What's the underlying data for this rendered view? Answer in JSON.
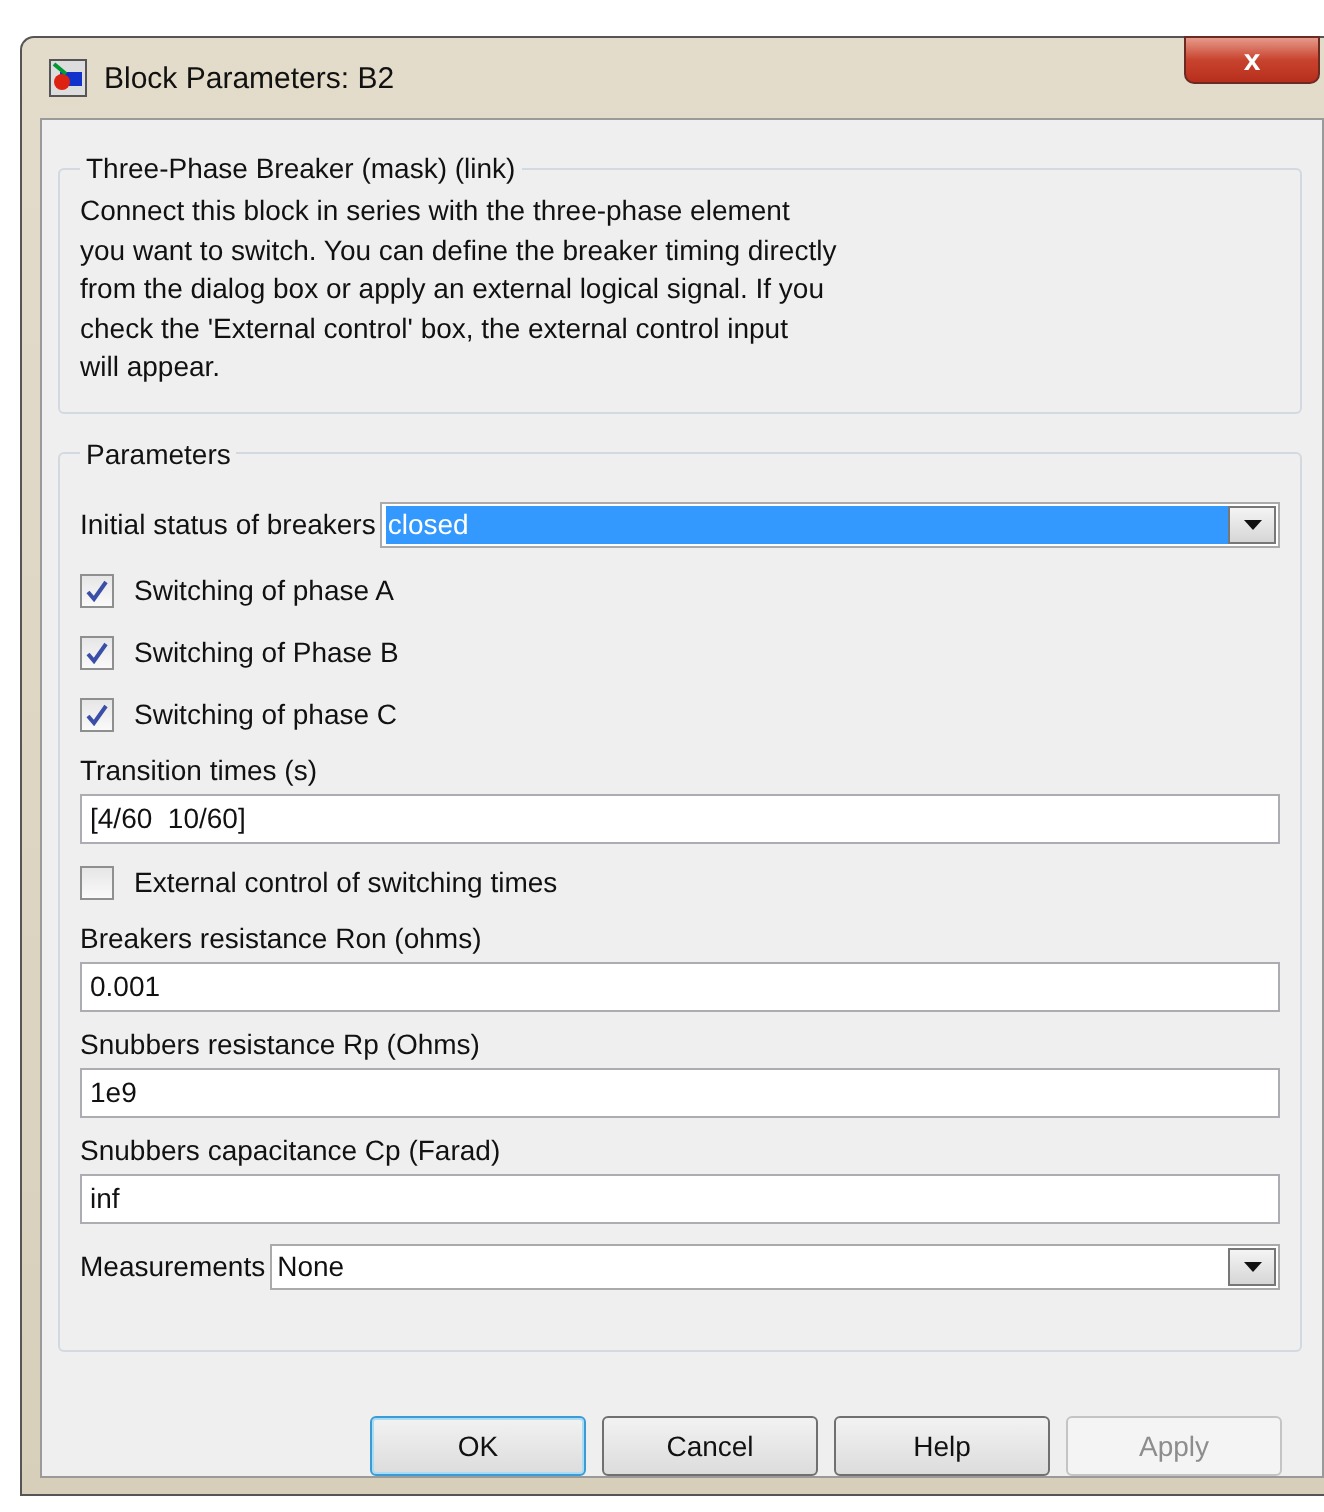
{
  "window": {
    "title": "Block Parameters: B2",
    "close": "x"
  },
  "description": {
    "heading": "Three-Phase Breaker (mask) (link)",
    "text": "Connect this block in series with the three-phase element\nyou want to switch. You can define the breaker timing directly\nfrom the dialog box or apply an external logical signal. If you\ncheck  the 'External control' box, the external control input\nwill appear."
  },
  "parameters": {
    "heading": "Parameters",
    "items": [
      {
        "kind": "dropdown",
        "label": "Initial status of breakers",
        "value": "closed",
        "focused": true
      },
      {
        "kind": "checkbox",
        "label": "Switching of phase A",
        "checked": true
      },
      {
        "kind": "checkbox",
        "label": "Switching of Phase B",
        "checked": true
      },
      {
        "kind": "checkbox",
        "label": "Switching of phase C",
        "checked": true
      },
      {
        "kind": "field",
        "label": "Transition times (s)",
        "value": "[4/60  10/60]"
      },
      {
        "kind": "checkbox",
        "label": "External control of switching times",
        "checked": false
      },
      {
        "kind": "field",
        "label": "Breakers resistance Ron (ohms)",
        "value": "0.001"
      },
      {
        "kind": "field",
        "label": "Snubbers resistance Rp (Ohms)",
        "value": "1e9"
      },
      {
        "kind": "field",
        "label": "Snubbers capacitance Cp (Farad)",
        "value": "inf"
      },
      {
        "kind": "dropdown",
        "label": "Measurements",
        "value": "None",
        "focused": false
      }
    ]
  },
  "buttons": [
    {
      "label": "OK",
      "default": true,
      "disabled": false
    },
    {
      "label": "Cancel",
      "default": false,
      "disabled": false
    },
    {
      "label": "Help",
      "default": false,
      "disabled": false
    },
    {
      "label": "Apply",
      "default": false,
      "disabled": true
    }
  ]
}
